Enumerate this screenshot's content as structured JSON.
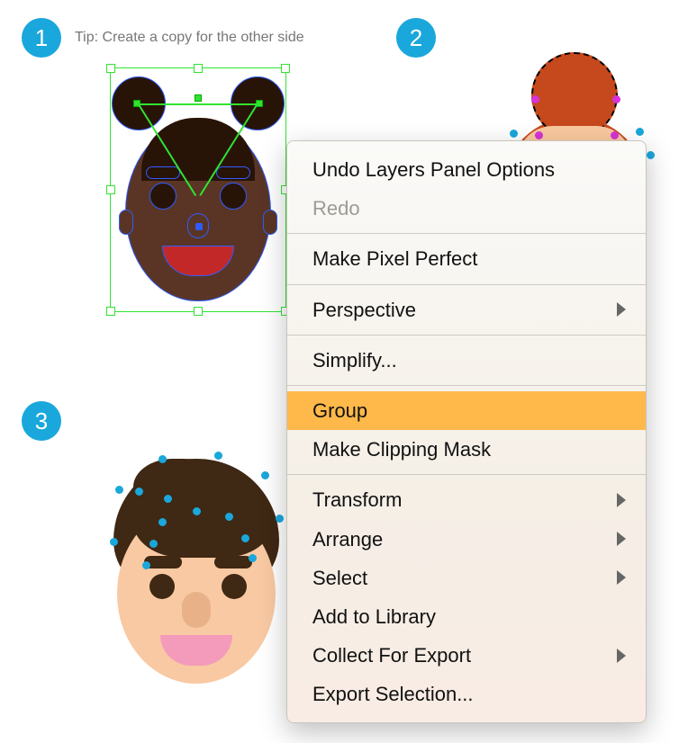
{
  "tip": "Tip: Create a copy for the other side",
  "steps": {
    "one": "1",
    "two": "2",
    "three": "3"
  },
  "menu": {
    "undo": "Undo Layers Panel Options",
    "redo": "Redo",
    "pixel": "Make Pixel Perfect",
    "perspective": "Perspective",
    "simplify": "Simplify...",
    "group": "Group",
    "clip": "Make Clipping Mask",
    "transform": "Transform",
    "arrange": "Arrange",
    "select": "Select",
    "library": "Add to Library",
    "collect": "Collect For Export",
    "export": "Export Selection..."
  }
}
